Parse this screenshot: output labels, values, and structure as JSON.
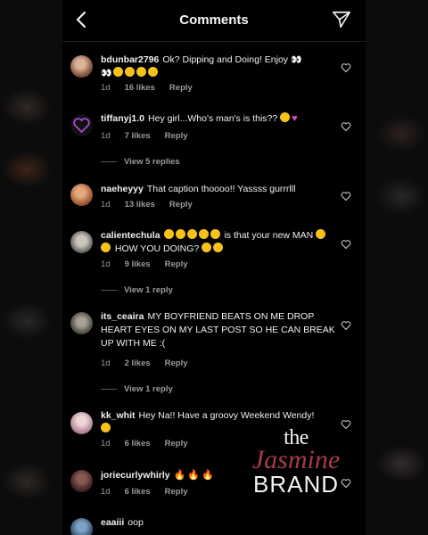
{
  "header": {
    "title": "Comments"
  },
  "comments": [
    {
      "username": "bdunbar2796",
      "text": "Ok? Dipping and Doing! Enjoy",
      "age": "1d",
      "likes": "16 likes",
      "reply": "Reply",
      "avatar_color": "#8a6a58"
    },
    {
      "username": "tiffanyj1.0",
      "text": "Hey girl...Who's man's is this??",
      "age": "1d",
      "likes": "7 likes",
      "reply": "Reply",
      "view_replies": "View 5 replies",
      "avatar_color": "#7a2f8a"
    },
    {
      "username": "naeheyyy",
      "text": "That caption thoooo!! Yassss gurrrlll",
      "age": "1d",
      "likes": "13 likes",
      "reply": "Reply",
      "avatar_color": "#b36a3c"
    },
    {
      "username": "calientechula",
      "text_prefix": "",
      "text_mid": "is that your new MAN",
      "text_mid2": "HOW YOU DOING?",
      "age": "1d",
      "likes": "9 likes",
      "reply": "Reply",
      "view_replies": "View 1 reply",
      "avatar_color": "#6b6b6b"
    },
    {
      "username": "its_ceaira",
      "text": "MY BOYFRIEND BEATS ON ME DROP HEART EYES ON MY LAST POST SO HE CAN BREAK UP WITH ME :(",
      "age": "1d",
      "likes": "2 likes",
      "reply": "Reply",
      "view_replies": "View 1 reply",
      "avatar_color": "#77736a"
    },
    {
      "username": "kk_whit",
      "text": "Hey Na!! Have a groovy Weekend Wendy!",
      "age": "1d",
      "likes": "6 likes",
      "reply": "Reply",
      "avatar_color": "#b98aa0"
    },
    {
      "username": "joriecurlywhirly",
      "text": "",
      "age": "1d",
      "likes": "6 likes",
      "reply": "Reply",
      "avatar_color": "#5a3a3a"
    },
    {
      "username": "eaaiii",
      "text": "oop",
      "avatar_color": "#3d5c7a"
    }
  ],
  "watermark": {
    "line1": "the",
    "line2": "Jasmine",
    "line3": "BRAND"
  },
  "colors": {
    "background": "#000000",
    "meta_text": "#9a9a9a",
    "text": "#f0f0f0"
  },
  "icons": {
    "back": "chevron-left-icon",
    "send": "paper-plane-icon",
    "like": "heart-outline-icon"
  }
}
